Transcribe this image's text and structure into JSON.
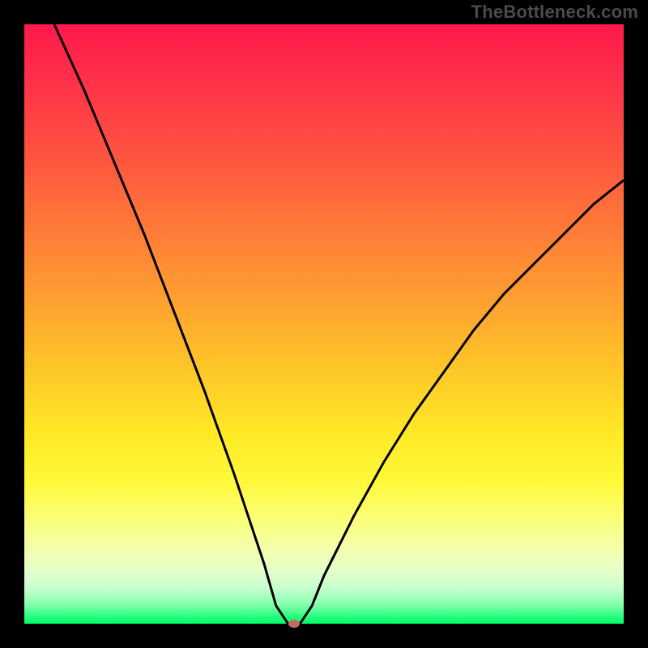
{
  "watermark": "TheBottleneck.com",
  "chart_data": {
    "type": "line",
    "title": "",
    "xlabel": "",
    "ylabel": "",
    "xlim": [
      0,
      100
    ],
    "ylim": [
      0,
      100
    ],
    "background_gradient": {
      "top": "#ff1a4b",
      "middle_upper": "#ff9a32",
      "middle": "#ffe826",
      "middle_lower": "#fbff72",
      "bottom": "#00ff66"
    },
    "series": [
      {
        "name": "bottleneck-curve",
        "x": [
          5,
          10,
          15,
          20,
          25,
          30,
          35,
          40,
          42,
          44,
          45,
          46,
          48,
          50,
          55,
          60,
          65,
          70,
          75,
          80,
          85,
          90,
          95,
          100
        ],
        "y": [
          100,
          89,
          77,
          65,
          52,
          39,
          25,
          10,
          3,
          0,
          0,
          0,
          3,
          8,
          18,
          27,
          35,
          42,
          49,
          55,
          60,
          65,
          70,
          74
        ]
      }
    ],
    "marker": {
      "x": 45,
      "y": 0,
      "color": "#c46a5e"
    },
    "grid": false,
    "legend": false
  }
}
